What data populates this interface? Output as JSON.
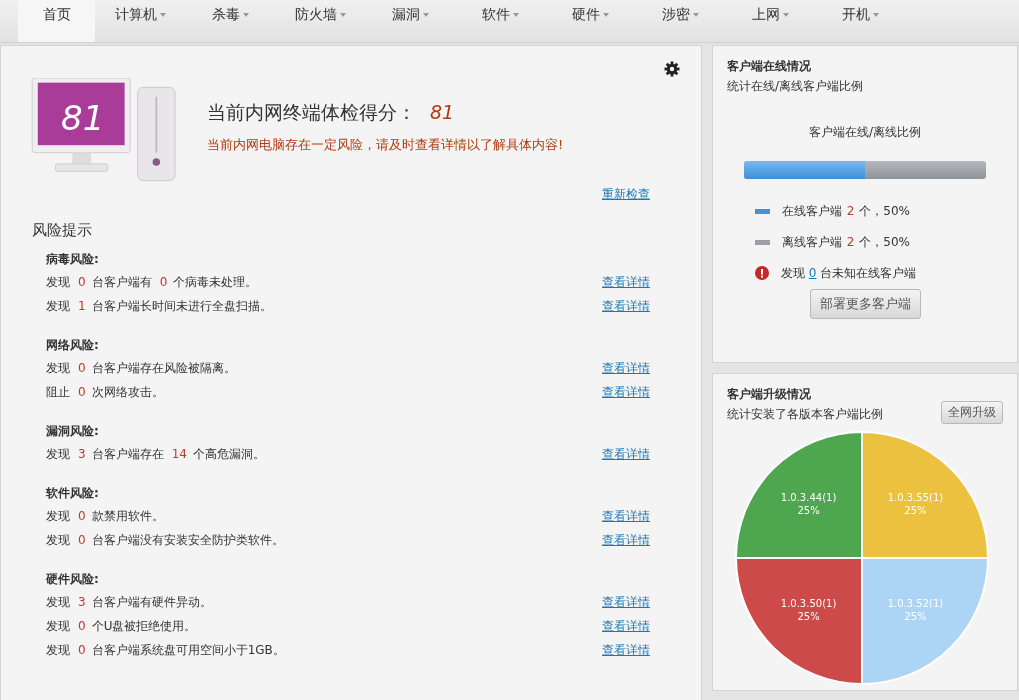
{
  "tabs": [
    {
      "label": "首页",
      "selected": true,
      "dropdown": false
    },
    {
      "label": "计算机",
      "selected": false,
      "dropdown": true
    },
    {
      "label": "杀毒",
      "selected": false,
      "dropdown": true
    },
    {
      "label": "防火墙",
      "selected": false,
      "dropdown": true
    },
    {
      "label": "漏洞",
      "selected": false,
      "dropdown": true
    },
    {
      "label": "软件",
      "selected": false,
      "dropdown": true
    },
    {
      "label": "硬件",
      "selected": false,
      "dropdown": true
    },
    {
      "label": "涉密",
      "selected": false,
      "dropdown": true
    },
    {
      "label": "上网",
      "selected": false,
      "dropdown": true
    },
    {
      "label": "开机",
      "selected": false,
      "dropdown": true
    }
  ],
  "summary": {
    "screen_score": "81",
    "score_label": "当前内网终端体检得分：",
    "score": "81",
    "warning": "当前内网电脑存在一定风险，请及时查看详情以了解具体内容!",
    "recheck_link": "重新检查"
  },
  "risks": {
    "title": "风险提示",
    "groups": [
      {
        "title": "病毒风险:",
        "rows": [
          {
            "segments": [
              {
                "kind": "text",
                "text": "发现"
              },
              {
                "kind": "num",
                "text": "0"
              },
              {
                "kind": "text",
                "text": "台客户端有"
              },
              {
                "kind": "num",
                "text": "0"
              },
              {
                "kind": "text",
                "text": "个病毒未处理。"
              }
            ],
            "link": "查看详情"
          },
          {
            "segments": [
              {
                "kind": "text",
                "text": "发现"
              },
              {
                "kind": "num",
                "text": "1"
              },
              {
                "kind": "text",
                "text": "台客户端长时间未进行全盘扫描。"
              }
            ],
            "link": "查看详情"
          }
        ]
      },
      {
        "title": "网络风险:",
        "rows": [
          {
            "segments": [
              {
                "kind": "text",
                "text": "发现"
              },
              {
                "kind": "num",
                "text": "0"
              },
              {
                "kind": "text",
                "text": "台客户端存在风险被隔离。"
              }
            ],
            "link": "查看详情"
          },
          {
            "segments": [
              {
                "kind": "text",
                "text": "阻止"
              },
              {
                "kind": "num",
                "text": "0"
              },
              {
                "kind": "text",
                "text": "次网络攻击。"
              }
            ],
            "link": "查看详情"
          }
        ]
      },
      {
        "title": "漏洞风险:",
        "rows": [
          {
            "segments": [
              {
                "kind": "text",
                "text": "发现"
              },
              {
                "kind": "num",
                "text": "3"
              },
              {
                "kind": "text",
                "text": "台客户端存在"
              },
              {
                "kind": "num",
                "text": "14"
              },
              {
                "kind": "text",
                "text": "个高危漏洞。"
              }
            ],
            "link": "查看详情"
          }
        ]
      },
      {
        "title": "软件风险:",
        "rows": [
          {
            "segments": [
              {
                "kind": "text",
                "text": "发现"
              },
              {
                "kind": "num",
                "text": "0"
              },
              {
                "kind": "text",
                "text": "款禁用软件。"
              }
            ],
            "link": "查看详情"
          },
          {
            "segments": [
              {
                "kind": "text",
                "text": "发现"
              },
              {
                "kind": "num",
                "text": "0"
              },
              {
                "kind": "text",
                "text": "台客户端没有安装安全防护类软件。"
              }
            ],
            "link": "查看详情"
          }
        ]
      },
      {
        "title": "硬件风险:",
        "rows": [
          {
            "segments": [
              {
                "kind": "text",
                "text": "发现"
              },
              {
                "kind": "num",
                "text": "3"
              },
              {
                "kind": "text",
                "text": "台客户端有硬件异动。"
              }
            ],
            "link": "查看详情"
          },
          {
            "segments": [
              {
                "kind": "text",
                "text": "发现"
              },
              {
                "kind": "num",
                "text": "0"
              },
              {
                "kind": "text",
                "text": "个U盘被拒绝使用。"
              }
            ],
            "link": "查看详情"
          },
          {
            "segments": [
              {
                "kind": "text",
                "text": "发现"
              },
              {
                "kind": "num",
                "text": "0"
              },
              {
                "kind": "text",
                "text": "台客户端系统盘可用空间小于1GB。"
              }
            ],
            "link": "查看详情"
          }
        ]
      }
    ]
  },
  "online": {
    "title": "客户端在线情况",
    "subtitle": "统计在线/离线客户端比例",
    "bar_title": "客户端在线/离线比例",
    "level": 0.5,
    "legend": [
      {
        "label": "在线客户端",
        "count": "2",
        "suffix": "个，50%",
        "color": "#4a90d9"
      },
      {
        "label": "离线客户端",
        "count": "2",
        "suffix": "个，50%",
        "color": "#9aa0a6"
      }
    ],
    "unknown": {
      "prefix": "发现",
      "count": "0",
      "suffix": "台未知在线客户端"
    },
    "deploy_button": "部署更多客户端"
  },
  "upgrade": {
    "title": "客户端升级情况",
    "subtitle": "统计安装了各版本客户端比例",
    "upgrade_button": "全网升级",
    "chart_data": {
      "type": "pie",
      "categories": [
        "1.0.3.55(1)",
        "1.0.3.52(1)",
        "1.0.3.50(1)",
        "1.0.3.44(1)"
      ],
      "values": [
        25,
        25,
        25,
        25
      ],
      "colors": [
        "#ecc13f",
        "#acd4f4",
        "#cd4a4a",
        "#4ea64e"
      ],
      "value_labels": [
        "25%",
        "25%",
        "25%",
        "25%"
      ]
    }
  }
}
